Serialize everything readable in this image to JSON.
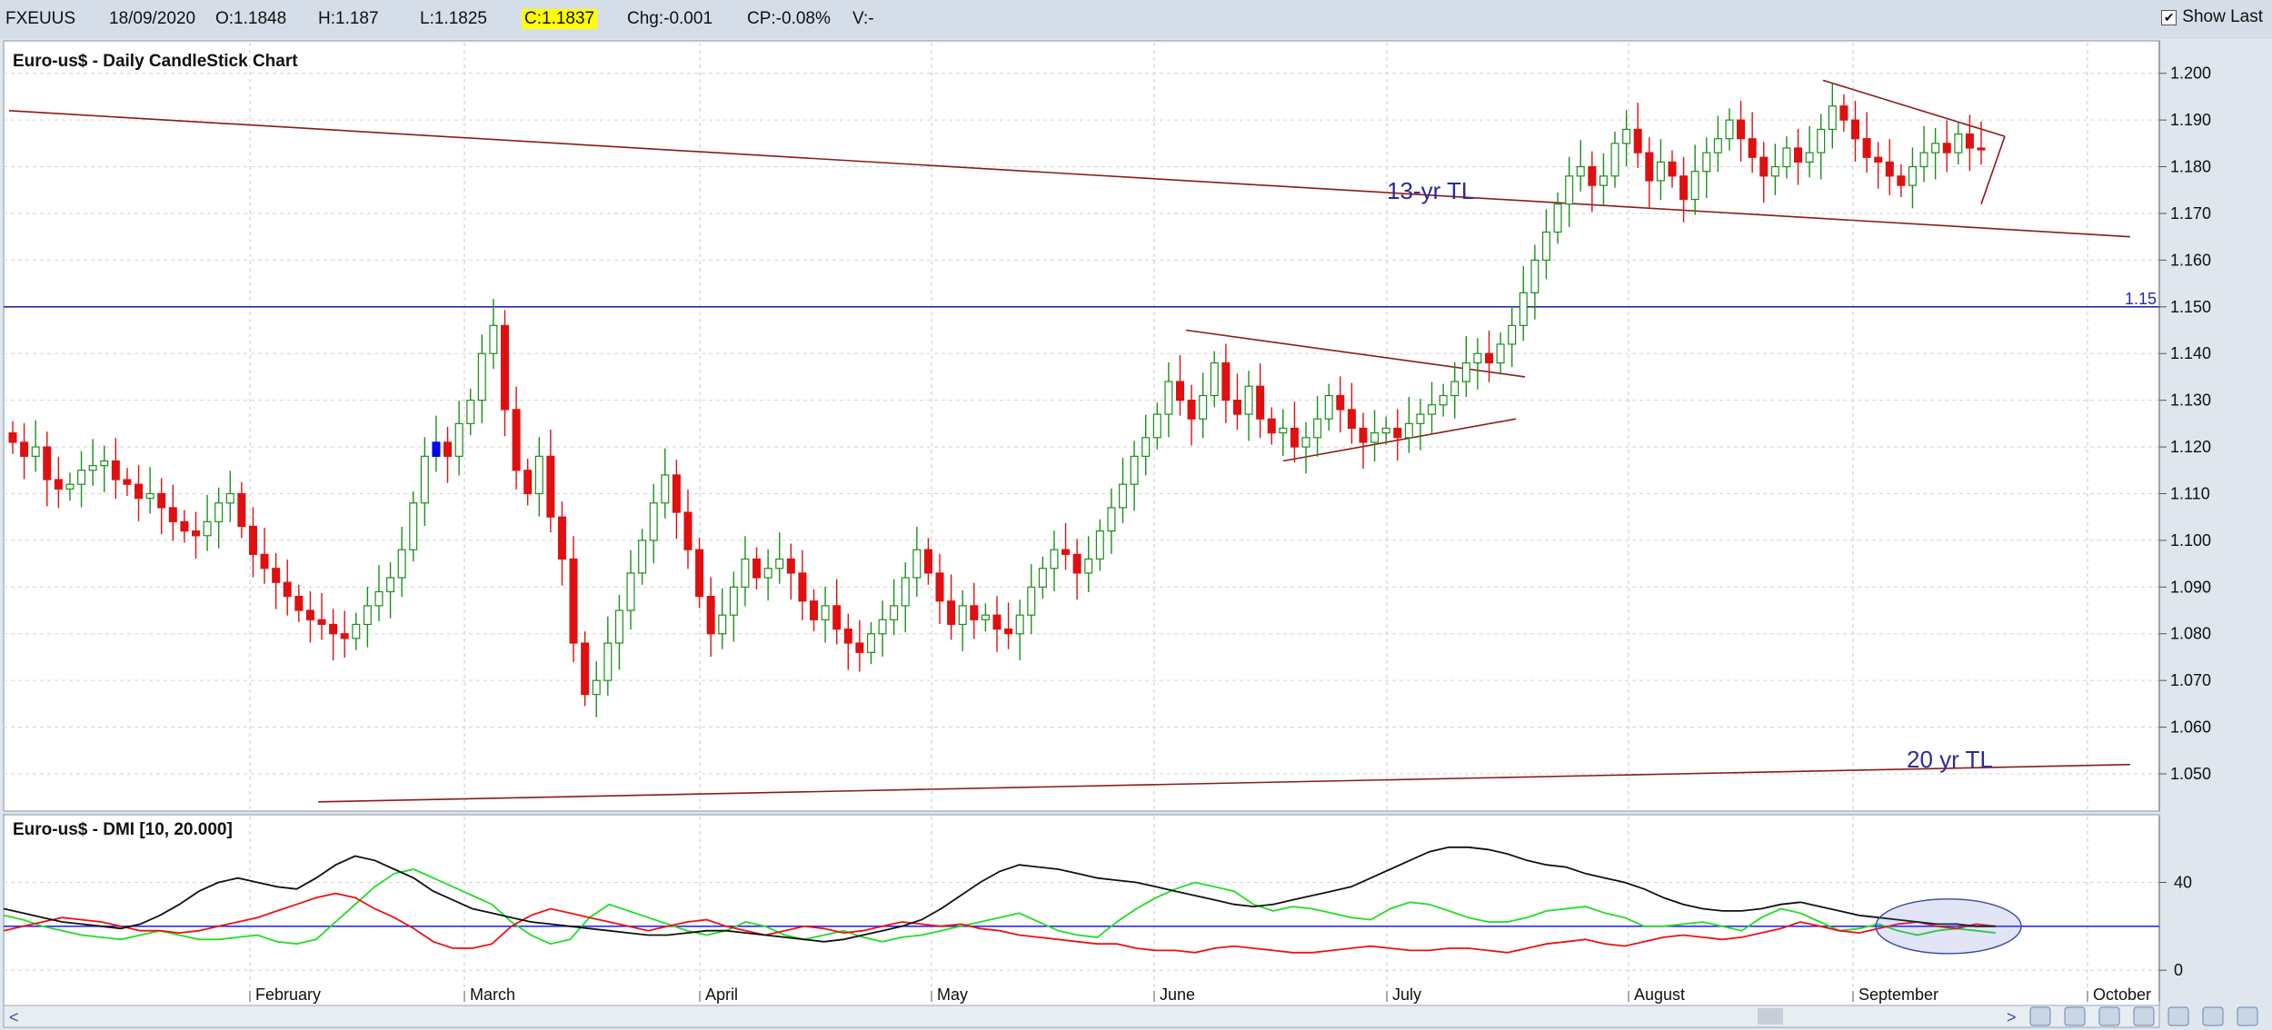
{
  "toolbar": {
    "symbol": "FXEUUS",
    "date": "18/09/2020",
    "open": "O:1.1848",
    "high": "H:1.187",
    "low": "L:1.1825",
    "close": "C:1.1837",
    "change": "Chg:-0.001",
    "change_pct": "CP:-0.08%",
    "volume": "V:-",
    "show_last_label": "Show Last",
    "show_last_checked": true
  },
  "colors": {
    "up": "#1a8f1a",
    "down": "#e01010",
    "special": "#0000ff",
    "trendline": "#8b1a1a",
    "level_line": "#2a2aa0",
    "plus_di": "#22dd22",
    "minus_di": "#ee1111",
    "adx": "#111111",
    "threshold": "#2a2aff"
  },
  "chart_data": [
    {
      "type": "candlestick",
      "title": "Euro-us$ - Daily CandleStick Chart",
      "ylim": [
        1.043,
        1.205
      ],
      "yticks": [
        "1.050",
        "1.060",
        "1.070",
        "1.080",
        "1.090",
        "1.100",
        "1.110",
        "1.120",
        "1.130",
        "1.140",
        "1.150",
        "1.160",
        "1.170",
        "1.180",
        "1.190",
        "1.200"
      ],
      "x_labels": [
        "February",
        "March",
        "April",
        "May",
        "June",
        "July",
        "August",
        "September",
        "October"
      ],
      "grid": true,
      "close_series": [
        1.121,
        1.118,
        1.12,
        1.113,
        1.111,
        1.112,
        1.115,
        1.116,
        1.117,
        1.113,
        1.112,
        1.109,
        1.11,
        1.107,
        1.104,
        1.102,
        1.101,
        1.104,
        1.108,
        1.11,
        1.103,
        1.097,
        1.094,
        1.091,
        1.088,
        1.085,
        1.083,
        1.082,
        1.08,
        1.079,
        1.082,
        1.086,
        1.089,
        1.092,
        1.098,
        1.108,
        1.118,
        1.121,
        1.118,
        1.125,
        1.13,
        1.14,
        1.146,
        1.128,
        1.115,
        1.11,
        1.118,
        1.105,
        1.096,
        1.078,
        1.067,
        1.07,
        1.078,
        1.085,
        1.093,
        1.1,
        1.108,
        1.114,
        1.106,
        1.098,
        1.088,
        1.08,
        1.084,
        1.09,
        1.096,
        1.092,
        1.094,
        1.096,
        1.093,
        1.087,
        1.083,
        1.086,
        1.081,
        1.078,
        1.076,
        1.08,
        1.083,
        1.086,
        1.092,
        1.098,
        1.093,
        1.087,
        1.082,
        1.086,
        1.083,
        1.084,
        1.081,
        1.08,
        1.084,
        1.09,
        1.094,
        1.098,
        1.097,
        1.093,
        1.096,
        1.102,
        1.107,
        1.112,
        1.118,
        1.122,
        1.127,
        1.134,
        1.13,
        1.126,
        1.131,
        1.138,
        1.13,
        1.127,
        1.133,
        1.126,
        1.123,
        1.124,
        1.12,
        1.122,
        1.126,
        1.131,
        1.128,
        1.124,
        1.121,
        1.123,
        1.124,
        1.122,
        1.125,
        1.127,
        1.129,
        1.131,
        1.134,
        1.138,
        1.14,
        1.138,
        1.142,
        1.146,
        1.153,
        1.16,
        1.166,
        1.172,
        1.178,
        1.18,
        1.176,
        1.178,
        1.185,
        1.188,
        1.183,
        1.177,
        1.181,
        1.178,
        1.173,
        1.179,
        1.183,
        1.186,
        1.19,
        1.186,
        1.182,
        1.178,
        1.18,
        1.184,
        1.181,
        1.183,
        1.188,
        1.193,
        1.19,
        1.186,
        1.182,
        1.181,
        1.178,
        1.176,
        1.18,
        1.183,
        1.185,
        1.183,
        1.187,
        1.184,
        1.1837
      ],
      "annotations": [
        {
          "text": "13-yr TL"
        },
        {
          "text": "20 yr TL"
        },
        {
          "text": "1.15"
        }
      ]
    },
    {
      "type": "line",
      "title": "Euro-us$ - DMI [10, 20.000]",
      "ylim": [
        -2,
        58
      ],
      "yticks": [
        "0",
        "40"
      ],
      "threshold": 20,
      "series": [
        {
          "values": [
            25,
            23,
            20,
            18,
            16,
            15,
            14,
            16,
            18,
            16,
            14,
            14,
            15,
            16,
            13,
            12,
            14,
            22,
            30,
            38,
            44,
            46,
            42,
            38,
            34,
            30,
            22,
            16,
            12,
            14,
            24,
            30,
            27,
            24,
            21,
            18,
            16,
            18,
            22,
            20,
            16,
            14,
            16,
            18,
            15,
            13,
            15,
            16,
            18,
            20,
            22,
            24,
            26,
            22,
            18,
            16,
            15,
            22,
            28,
            33,
            37,
            40,
            38,
            36,
            30,
            27,
            29,
            28,
            26,
            24,
            23,
            28,
            31,
            30,
            27,
            24,
            22,
            22,
            24,
            27,
            28,
            29,
            26,
            24,
            20,
            20,
            21,
            22,
            20,
            18,
            24,
            28,
            26,
            22,
            18,
            19,
            21,
            18,
            16,
            18,
            19,
            18,
            17
          ]
        },
        {
          "values": [
            18,
            20,
            22,
            24,
            23,
            22,
            20,
            18,
            18,
            17,
            18,
            20,
            22,
            24,
            27,
            30,
            33,
            35,
            33,
            28,
            24,
            19,
            13,
            10,
            10,
            12,
            20,
            25,
            28,
            26,
            24,
            22,
            20,
            18,
            20,
            22,
            23,
            20,
            18,
            16,
            18,
            20,
            19,
            17,
            18,
            20,
            22,
            21,
            20,
            21,
            19,
            18,
            16,
            15,
            14,
            13,
            12,
            12,
            10,
            9,
            9,
            8,
            10,
            11,
            10,
            9,
            8,
            8,
            9,
            10,
            11,
            10,
            9,
            9,
            10,
            10,
            9,
            8,
            10,
            12,
            13,
            14,
            12,
            11,
            13,
            15,
            16,
            15,
            14,
            15,
            17,
            19,
            22,
            20,
            18,
            17,
            19,
            21,
            22,
            20,
            19,
            21,
            20
          ]
        },
        {
          "values": [
            28,
            26,
            24,
            22,
            21,
            20,
            19,
            21,
            25,
            30,
            36,
            40,
            42,
            40,
            38,
            37,
            42,
            48,
            52,
            50,
            46,
            42,
            36,
            32,
            28,
            26,
            24,
            22,
            21,
            20,
            19,
            18,
            17,
            16,
            16,
            17,
            18,
            18,
            17,
            16,
            15,
            14,
            13,
            14,
            16,
            18,
            20,
            23,
            28,
            34,
            40,
            45,
            48,
            47,
            46,
            44,
            42,
            41,
            40,
            38,
            36,
            34,
            32,
            30,
            29,
            30,
            32,
            34,
            36,
            38,
            42,
            46,
            50,
            54,
            56,
            56,
            55,
            53,
            50,
            48,
            47,
            44,
            42,
            40,
            37,
            33,
            30,
            28,
            27,
            27,
            28,
            30,
            31,
            29,
            27,
            25,
            24,
            23,
            22,
            21,
            21,
            20,
            20
          ]
        }
      ]
    }
  ]
}
